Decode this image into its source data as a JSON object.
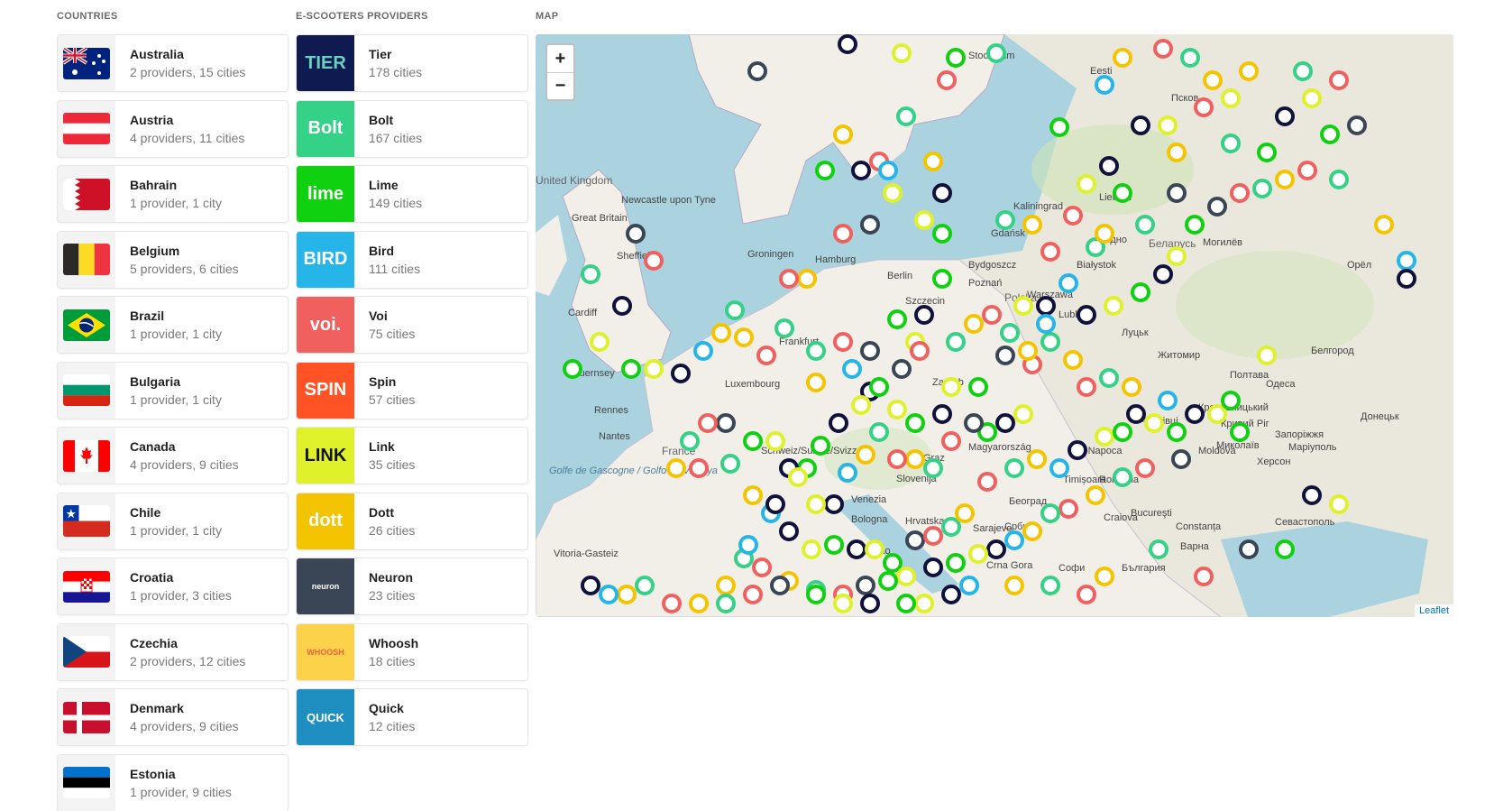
{
  "headers": {
    "countries": "COUNTRIES",
    "providers": "E-SCOOTERS PROVIDERS",
    "map": "MAP"
  },
  "countries": [
    {
      "name": "Australia",
      "summary": "2 providers, 15 cities",
      "flag": "australia"
    },
    {
      "name": "Austria",
      "summary": "4 providers, 11 cities",
      "flag": "austria"
    },
    {
      "name": "Bahrain",
      "summary": "1 provider, 1 city",
      "flag": "bahrain"
    },
    {
      "name": "Belgium",
      "summary": "5 providers, 6 cities",
      "flag": "belgium"
    },
    {
      "name": "Brazil",
      "summary": "1 provider, 1 city",
      "flag": "brazil"
    },
    {
      "name": "Bulgaria",
      "summary": "1 provider, 1 city",
      "flag": "bulgaria"
    },
    {
      "name": "Canada",
      "summary": "4 providers, 9 cities",
      "flag": "canada"
    },
    {
      "name": "Chile",
      "summary": "1 provider, 1 city",
      "flag": "chile"
    },
    {
      "name": "Croatia",
      "summary": "1 provider, 3 cities",
      "flag": "croatia"
    },
    {
      "name": "Czechia",
      "summary": "2 providers, 12 cities",
      "flag": "czechia"
    },
    {
      "name": "Denmark",
      "summary": "4 providers, 9 cities",
      "flag": "denmark"
    },
    {
      "name": "Estonia",
      "summary": "1 provider, 9 cities",
      "flag": "estonia"
    }
  ],
  "providers": [
    {
      "name": "Tier",
      "summary": "178 cities",
      "logo_text": "TIER",
      "bg": "#0e1a50",
      "fg": "#69d2c3"
    },
    {
      "name": "Bolt",
      "summary": "167 cities",
      "logo_text": "Bolt",
      "bg": "#34d186",
      "fg": "#ffffff"
    },
    {
      "name": "Lime",
      "summary": "149 cities",
      "logo_text": "lime",
      "bg": "#0fd10f",
      "fg": "#ffffff"
    },
    {
      "name": "Bird",
      "summary": "111 cities",
      "logo_text": "BIRD",
      "bg": "#26b5e8",
      "fg": "#ffffff"
    },
    {
      "name": "Voi",
      "summary": "75 cities",
      "logo_text": "voi.",
      "bg": "#f0605f",
      "fg": "#ffffff"
    },
    {
      "name": "Spin",
      "summary": "57 cities",
      "logo_text": "SPIN",
      "bg": "#ff5325",
      "fg": "#ffffff"
    },
    {
      "name": "Link",
      "summary": "35 cities",
      "logo_text": "LINK",
      "bg": "#def12a",
      "fg": "#111111"
    },
    {
      "name": "Dott",
      "summary": "26 cities",
      "logo_text": "dott",
      "bg": "#f5c400",
      "fg": "#ffffff"
    },
    {
      "name": "Neuron",
      "summary": "23 cities",
      "logo_text": "neuron",
      "bg": "#3a4655",
      "fg": "#ffffff"
    },
    {
      "name": "Whoosh",
      "summary": "18 cities",
      "logo_text": "WHOOSH",
      "bg": "#fdd24b",
      "fg": "#e8643a"
    },
    {
      "name": "Quick",
      "summary": "12 cities",
      "logo_text": "QUICK",
      "bg": "#1f8fc1",
      "fg": "#ffffff"
    }
  ],
  "map": {
    "zoom_in": "+",
    "zoom_out": "−",
    "attribution": "Leaflet",
    "places": [
      {
        "label": "United Kingdom"
      },
      {
        "label": "Newcastle upon Tyne"
      },
      {
        "label": "Great Britain"
      },
      {
        "label": "Sheffield"
      },
      {
        "label": "Cardiff"
      },
      {
        "label": "Guernsey"
      },
      {
        "label": "Rennes"
      },
      {
        "label": "Nantes"
      },
      {
        "label": "France"
      },
      {
        "label": "Golfe de Gascogne / Golfo de Vizcaya"
      },
      {
        "label": "Groningen"
      },
      {
        "label": "Hamburg"
      },
      {
        "label": "Berlin"
      },
      {
        "label": "Frankfurt"
      },
      {
        "label": "Luxembourg"
      },
      {
        "label": "Szczecin"
      },
      {
        "label": "Bydgoszcz"
      },
      {
        "label": "Poznań"
      },
      {
        "label": "Polska"
      },
      {
        "label": "Warszawa"
      },
      {
        "label": "Lublin"
      },
      {
        "label": "Kaliningrad"
      },
      {
        "label": "Gdańsk"
      },
      {
        "label": "Lietuva"
      },
      {
        "label": "Гродно"
      },
      {
        "label": "Białystok"
      },
      {
        "label": "Беларусь"
      },
      {
        "label": "Могилёв"
      },
      {
        "label": "Псков"
      },
      {
        "label": "Eesti"
      },
      {
        "label": "Stockholm"
      },
      {
        "label": "Slovenija"
      },
      {
        "label": "Hrvatska"
      },
      {
        "label": "Magyarország"
      },
      {
        "label": "Cluj-Napoca"
      },
      {
        "label": "România"
      },
      {
        "label": "Bucureşti"
      },
      {
        "label": "Constanța"
      },
      {
        "label": "Варна"
      },
      {
        "label": "България"
      },
      {
        "label": "Sarajevo"
      },
      {
        "label": "Београд"
      },
      {
        "label": "Србија"
      },
      {
        "label": "Craiova"
      },
      {
        "label": "Timișoara"
      },
      {
        "label": "Moldova"
      },
      {
        "label": "Херсон"
      },
      {
        "label": "Житомир"
      },
      {
        "label": "Полтава"
      },
      {
        "label": "Одеса"
      },
      {
        "label": "Кропивницький"
      },
      {
        "label": "Кривий Ріг"
      },
      {
        "label": "Запоріжжя"
      },
      {
        "label": "Марiуполь"
      },
      {
        "label": "Миколаїв"
      },
      {
        "label": "Севастополь"
      },
      {
        "label": "Белгород"
      },
      {
        "label": "Донецьк"
      },
      {
        "label": "Орёл"
      },
      {
        "label": "Луцьк"
      },
      {
        "label": "Чернівці"
      },
      {
        "label": "Zagreb"
      },
      {
        "label": "Venezia"
      },
      {
        "label": "Bologna"
      },
      {
        "label": "Marino"
      },
      {
        "label": "Crna Gora"
      },
      {
        "label": "Софи"
      },
      {
        "label": "Graz"
      },
      {
        "label": "Schweiz/Suisse/Svizzera"
      },
      {
        "label": "Vitoria-Gasteiz"
      }
    ]
  }
}
